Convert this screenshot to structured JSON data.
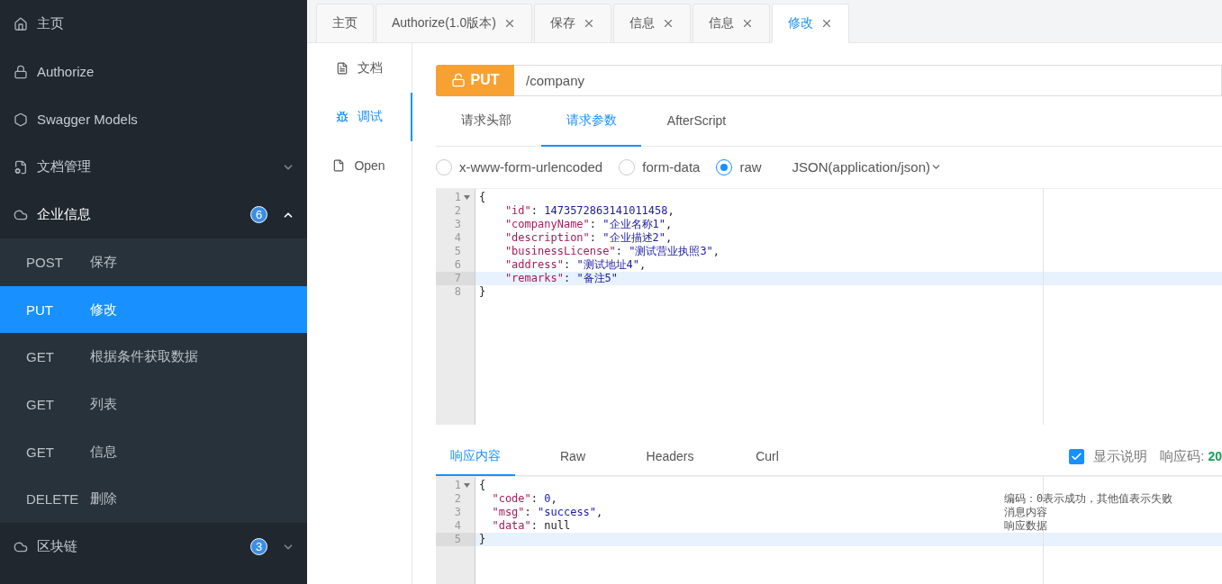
{
  "sidebar": {
    "items": [
      {
        "label": "主页"
      },
      {
        "label": "Authorize"
      },
      {
        "label": "Swagger Models"
      },
      {
        "label": "文档管理",
        "expanded": false
      },
      {
        "label": "企业信息",
        "badge": "6",
        "expanded": true,
        "children": [
          {
            "method": "POST",
            "name": "保存",
            "selected": false
          },
          {
            "method": "PUT",
            "name": "修改",
            "selected": true
          },
          {
            "method": "GET",
            "name": "根据条件获取数据",
            "selected": false
          },
          {
            "method": "GET",
            "name": "列表",
            "selected": false
          },
          {
            "method": "GET",
            "name": "信息",
            "selected": false
          },
          {
            "method": "DELETE",
            "name": "删除",
            "selected": false
          }
        ]
      },
      {
        "label": "区块链",
        "badge": "3",
        "expanded": false
      }
    ]
  },
  "tabs": [
    {
      "label": "主页",
      "closable": false,
      "selected": false
    },
    {
      "label": "Authorize(1.0版本)",
      "closable": true,
      "selected": false
    },
    {
      "label": "保存",
      "closable": true,
      "selected": false
    },
    {
      "label": "信息",
      "closable": true,
      "selected": false
    },
    {
      "label": "信息",
      "closable": true,
      "selected": false
    },
    {
      "label": "修改",
      "closable": true,
      "selected": true
    }
  ],
  "doc_nav": [
    {
      "label": "文档",
      "selected": false
    },
    {
      "label": "调试",
      "selected": true
    },
    {
      "label": "Open",
      "selected": false
    }
  ],
  "request": {
    "method": "PUT",
    "path": "/company"
  },
  "param_tabs": [
    {
      "label": "请求头部",
      "selected": false
    },
    {
      "label": "请求参数",
      "selected": true
    },
    {
      "label": "AfterScript",
      "selected": false
    }
  ],
  "body_types": [
    {
      "label": "x-www-form-urlencoded",
      "selected": false
    },
    {
      "label": "form-data",
      "selected": false
    },
    {
      "label": "raw",
      "selected": true
    }
  ],
  "content_type": "JSON(application/json)",
  "request_editor": {
    "lines": [
      {
        "number": "1",
        "fold": true,
        "active": false,
        "parts": [
          {
            "kind": "punct",
            "text": "{"
          }
        ]
      },
      {
        "number": "2",
        "fold": false,
        "active": false,
        "parts": [
          {
            "kind": "key",
            "text": "    \"id\""
          },
          {
            "kind": "punct",
            "text": ": "
          },
          {
            "kind": "number",
            "text": "1473572863141011458"
          },
          {
            "kind": "punct",
            "text": ","
          }
        ]
      },
      {
        "number": "3",
        "fold": false,
        "active": false,
        "parts": [
          {
            "kind": "key",
            "text": "    \"companyName\""
          },
          {
            "kind": "punct",
            "text": ": "
          },
          {
            "kind": "string",
            "text": "\"企业名称1\""
          },
          {
            "kind": "punct",
            "text": ","
          }
        ]
      },
      {
        "number": "4",
        "fold": false,
        "active": false,
        "parts": [
          {
            "kind": "key",
            "text": "    \"description\""
          },
          {
            "kind": "punct",
            "text": ": "
          },
          {
            "kind": "string",
            "text": "\"企业描述2\""
          },
          {
            "kind": "punct",
            "text": ","
          }
        ]
      },
      {
        "number": "5",
        "fold": false,
        "active": false,
        "parts": [
          {
            "kind": "key",
            "text": "    \"businessLicense\""
          },
          {
            "kind": "punct",
            "text": ": "
          },
          {
            "kind": "string",
            "text": "\"测试营业执照3\""
          },
          {
            "kind": "punct",
            "text": ","
          }
        ]
      },
      {
        "number": "6",
        "fold": false,
        "active": false,
        "parts": [
          {
            "kind": "key",
            "text": "    \"address\""
          },
          {
            "kind": "punct",
            "text": ": "
          },
          {
            "kind": "string",
            "text": "\"测试地址4\""
          },
          {
            "kind": "punct",
            "text": ","
          }
        ]
      },
      {
        "number": "7",
        "fold": false,
        "active": true,
        "parts": [
          {
            "kind": "key",
            "text": "    \"remarks\""
          },
          {
            "kind": "punct",
            "text": ": "
          },
          {
            "kind": "string",
            "text": "\"备注5\""
          }
        ]
      },
      {
        "number": "8",
        "fold": false,
        "active": false,
        "parts": [
          {
            "kind": "punct",
            "text": "}"
          }
        ]
      }
    ]
  },
  "response_tabs": [
    {
      "label": "响应内容",
      "selected": true
    },
    {
      "label": "Raw",
      "selected": false
    },
    {
      "label": "Headers",
      "selected": false
    },
    {
      "label": "Curl",
      "selected": false
    }
  ],
  "show_notes": {
    "label": "显示说明",
    "checked": true
  },
  "status": {
    "label": "响应码:",
    "value": "20"
  },
  "response_editor": {
    "lines": [
      {
        "number": "1",
        "fold": true,
        "active": false,
        "parts": [
          {
            "kind": "punct",
            "text": "{"
          }
        ]
      },
      {
        "number": "2",
        "fold": false,
        "active": false,
        "note": "编码：0表示成功，其他值表示失败",
        "parts": [
          {
            "kind": "key",
            "text": "  \"code\""
          },
          {
            "kind": "punct",
            "text": ": "
          },
          {
            "kind": "number",
            "text": "0"
          },
          {
            "kind": "punct",
            "text": ","
          }
        ]
      },
      {
        "number": "3",
        "fold": false,
        "active": false,
        "note": "消息内容",
        "parts": [
          {
            "kind": "key",
            "text": "  \"msg\""
          },
          {
            "kind": "punct",
            "text": ": "
          },
          {
            "kind": "string",
            "text": "\"success\""
          },
          {
            "kind": "punct",
            "text": ","
          }
        ]
      },
      {
        "number": "4",
        "fold": false,
        "active": false,
        "note": "响应数据",
        "parts": [
          {
            "kind": "key",
            "text": "  \"data\""
          },
          {
            "kind": "punct",
            "text": ": "
          },
          {
            "kind": "plain",
            "text": "null"
          }
        ]
      },
      {
        "number": "5",
        "fold": false,
        "active": true,
        "parts": [
          {
            "kind": "punct",
            "text": "}"
          }
        ]
      }
    ]
  }
}
